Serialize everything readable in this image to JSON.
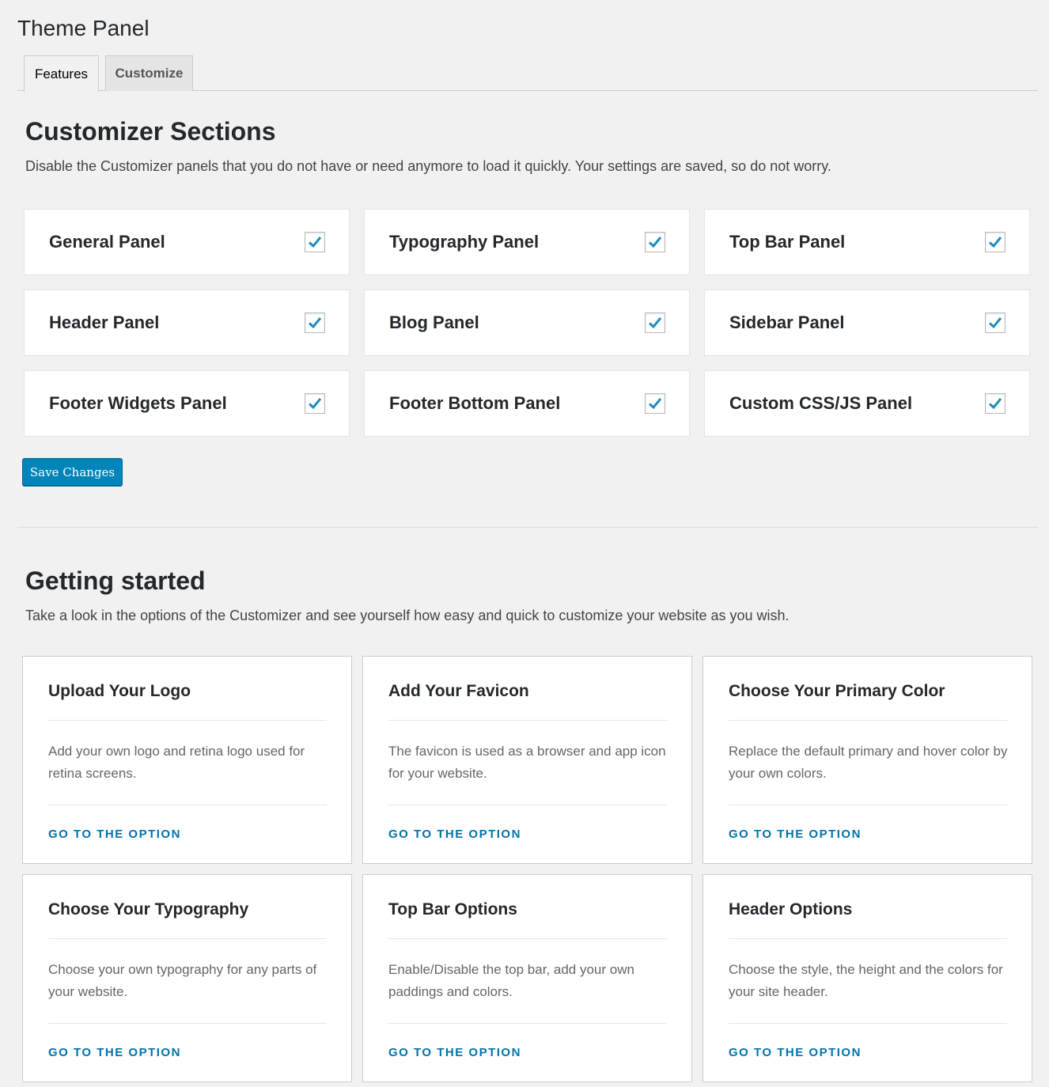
{
  "page": {
    "title": "Theme Panel"
  },
  "tabs": [
    {
      "label": "Features",
      "active": true
    },
    {
      "label": "Customize",
      "active": false
    }
  ],
  "customizer": {
    "title": "Customizer Sections",
    "description": "Disable the Customizer panels that you do not have or need anymore to load it quickly. Your settings are saved, so do not worry.",
    "panels": [
      {
        "label": "General Panel",
        "checked": true
      },
      {
        "label": "Typography Panel",
        "checked": true
      },
      {
        "label": "Top Bar Panel",
        "checked": true
      },
      {
        "label": "Header Panel",
        "checked": true
      },
      {
        "label": "Blog Panel",
        "checked": true
      },
      {
        "label": "Sidebar Panel",
        "checked": true
      },
      {
        "label": "Footer Widgets Panel",
        "checked": true
      },
      {
        "label": "Footer Bottom Panel",
        "checked": true
      },
      {
        "label": "Custom CSS/JS Panel",
        "checked": true
      }
    ],
    "save_label": "Save Changes"
  },
  "getting_started": {
    "title": "Getting started",
    "description": "Take a look in the options of the Customizer and see yourself how easy and quick to customize your website as you wish.",
    "cards": [
      {
        "title": "Upload Your Logo",
        "description": "Add your own logo and retina logo used for retina screens.",
        "link": "GO TO THE OPTION"
      },
      {
        "title": "Add Your Favicon",
        "description": "The favicon is used as a browser and app icon for your website.",
        "link": "GO TO THE OPTION"
      },
      {
        "title": "Choose Your Primary Color",
        "description": "Replace the default primary and hover color by your own colors.",
        "link": "GO TO THE OPTION"
      },
      {
        "title": "Choose Your Typography",
        "description": "Choose your own typography for any parts of your website.",
        "link": "GO TO THE OPTION"
      },
      {
        "title": "Top Bar Options",
        "description": "Enable/Disable the top bar, add your own paddings and colors.",
        "link": "GO TO THE OPTION"
      },
      {
        "title": "Header Options",
        "description": "Choose the style, the height and the colors for your site header.",
        "link": "GO TO THE OPTION"
      }
    ]
  },
  "colors": {
    "accent": "#0085ba",
    "link": "#0073aa",
    "check": "#1e8cbe"
  }
}
